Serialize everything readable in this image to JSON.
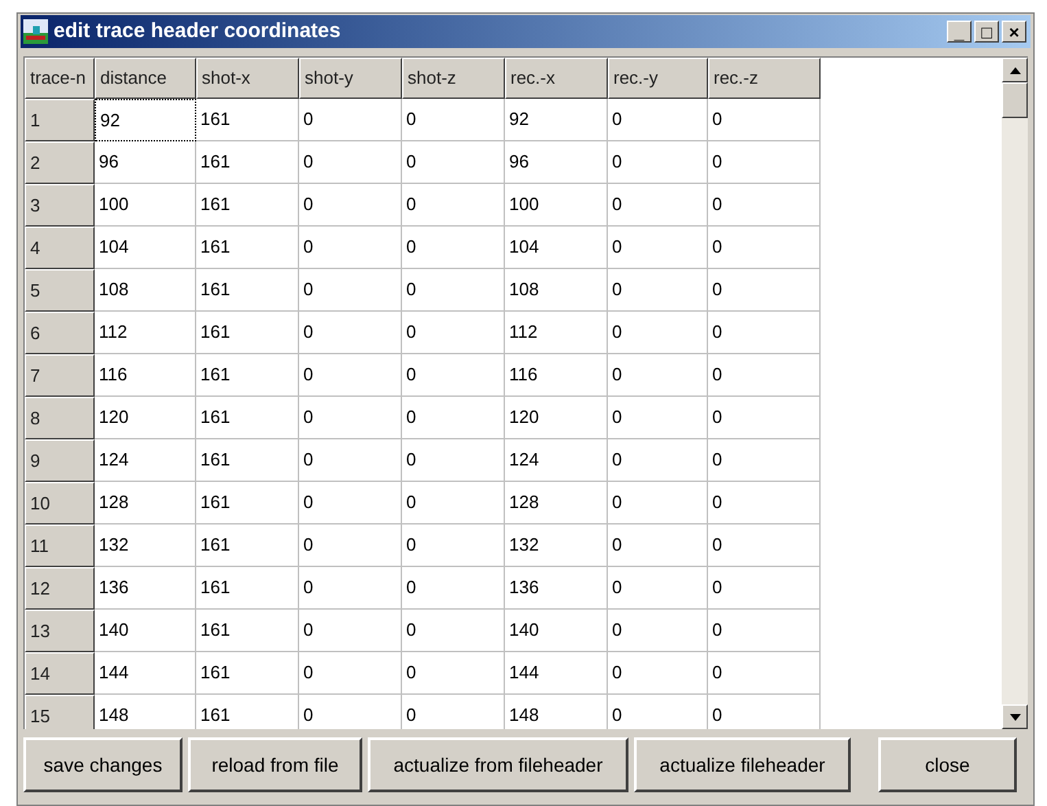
{
  "window": {
    "title": "edit trace header coordinates",
    "controls": [
      "_",
      "□",
      "×"
    ]
  },
  "table": {
    "columns": [
      "trace-n",
      "distance",
      "shot-x",
      "shot-y",
      "shot-z",
      "rec.-x",
      "rec.-y",
      "rec.-z"
    ],
    "rows": [
      {
        "focused": true,
        "cells": [
          "1",
          "92",
          "161",
          "0",
          "0",
          "92",
          "0",
          "0"
        ]
      },
      {
        "focused": false,
        "cells": [
          "2",
          "96",
          "161",
          "0",
          "0",
          "96",
          "0",
          "0"
        ]
      },
      {
        "focused": false,
        "cells": [
          "3",
          "100",
          "161",
          "0",
          "0",
          "100",
          "0",
          "0"
        ]
      },
      {
        "focused": false,
        "cells": [
          "4",
          "104",
          "161",
          "0",
          "0",
          "104",
          "0",
          "0"
        ]
      },
      {
        "focused": false,
        "cells": [
          "5",
          "108",
          "161",
          "0",
          "0",
          "108",
          "0",
          "0"
        ]
      },
      {
        "focused": false,
        "cells": [
          "6",
          "112",
          "161",
          "0",
          "0",
          "112",
          "0",
          "0"
        ]
      },
      {
        "focused": false,
        "cells": [
          "7",
          "116",
          "161",
          "0",
          "0",
          "116",
          "0",
          "0"
        ]
      },
      {
        "focused": false,
        "cells": [
          "8",
          "120",
          "161",
          "0",
          "0",
          "120",
          "0",
          "0"
        ]
      },
      {
        "focused": false,
        "cells": [
          "9",
          "124",
          "161",
          "0",
          "0",
          "124",
          "0",
          "0"
        ]
      },
      {
        "focused": false,
        "cells": [
          "10",
          "128",
          "161",
          "0",
          "0",
          "128",
          "0",
          "0"
        ]
      },
      {
        "focused": false,
        "cells": [
          "11",
          "132",
          "161",
          "0",
          "0",
          "132",
          "0",
          "0"
        ]
      },
      {
        "focused": false,
        "cells": [
          "12",
          "136",
          "161",
          "0",
          "0",
          "136",
          "0",
          "0"
        ]
      },
      {
        "focused": false,
        "cells": [
          "13",
          "140",
          "161",
          "0",
          "0",
          "140",
          "0",
          "0"
        ]
      },
      {
        "focused": false,
        "cells": [
          "14",
          "144",
          "161",
          "0",
          "0",
          "144",
          "0",
          "0"
        ]
      },
      {
        "focused": false,
        "cells": [
          "15",
          "148",
          "161",
          "0",
          "0",
          "148",
          "0",
          "0"
        ]
      }
    ]
  },
  "buttons": [
    "save changes",
    "reload from file",
    "actualize from fileheader",
    "actualize fileheader",
    "close"
  ]
}
